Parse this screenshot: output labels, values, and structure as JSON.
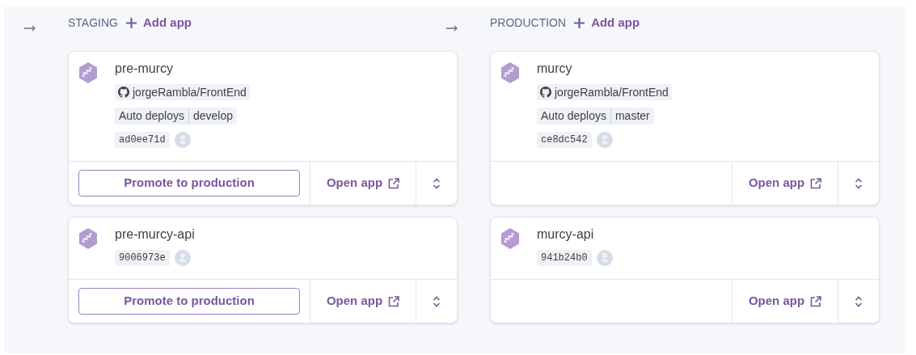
{
  "stages": [
    {
      "name": "STAGING",
      "add_label": "Add app",
      "apps": [
        {
          "name": "pre-murcy",
          "repo": "jorgeRambla/FrontEnd",
          "auto_deploys": "Auto deploys",
          "branch": "develop",
          "commit": "ad0ee71d",
          "promote": "Promote to production",
          "open": "Open app"
        },
        {
          "name": "pre-murcy-api",
          "commit": "9006973e",
          "promote": "Promote to production",
          "open": "Open app"
        }
      ]
    },
    {
      "name": "PRODUCTION",
      "add_label": "Add app",
      "apps": [
        {
          "name": "murcy",
          "repo": "jorgeRambla/FrontEnd",
          "auto_deploys": "Auto deploys",
          "branch": "master",
          "commit": "ce8dc542",
          "open": "Open app"
        },
        {
          "name": "murcy-api",
          "commit": "941b24b0",
          "open": "Open app"
        }
      ]
    }
  ]
}
